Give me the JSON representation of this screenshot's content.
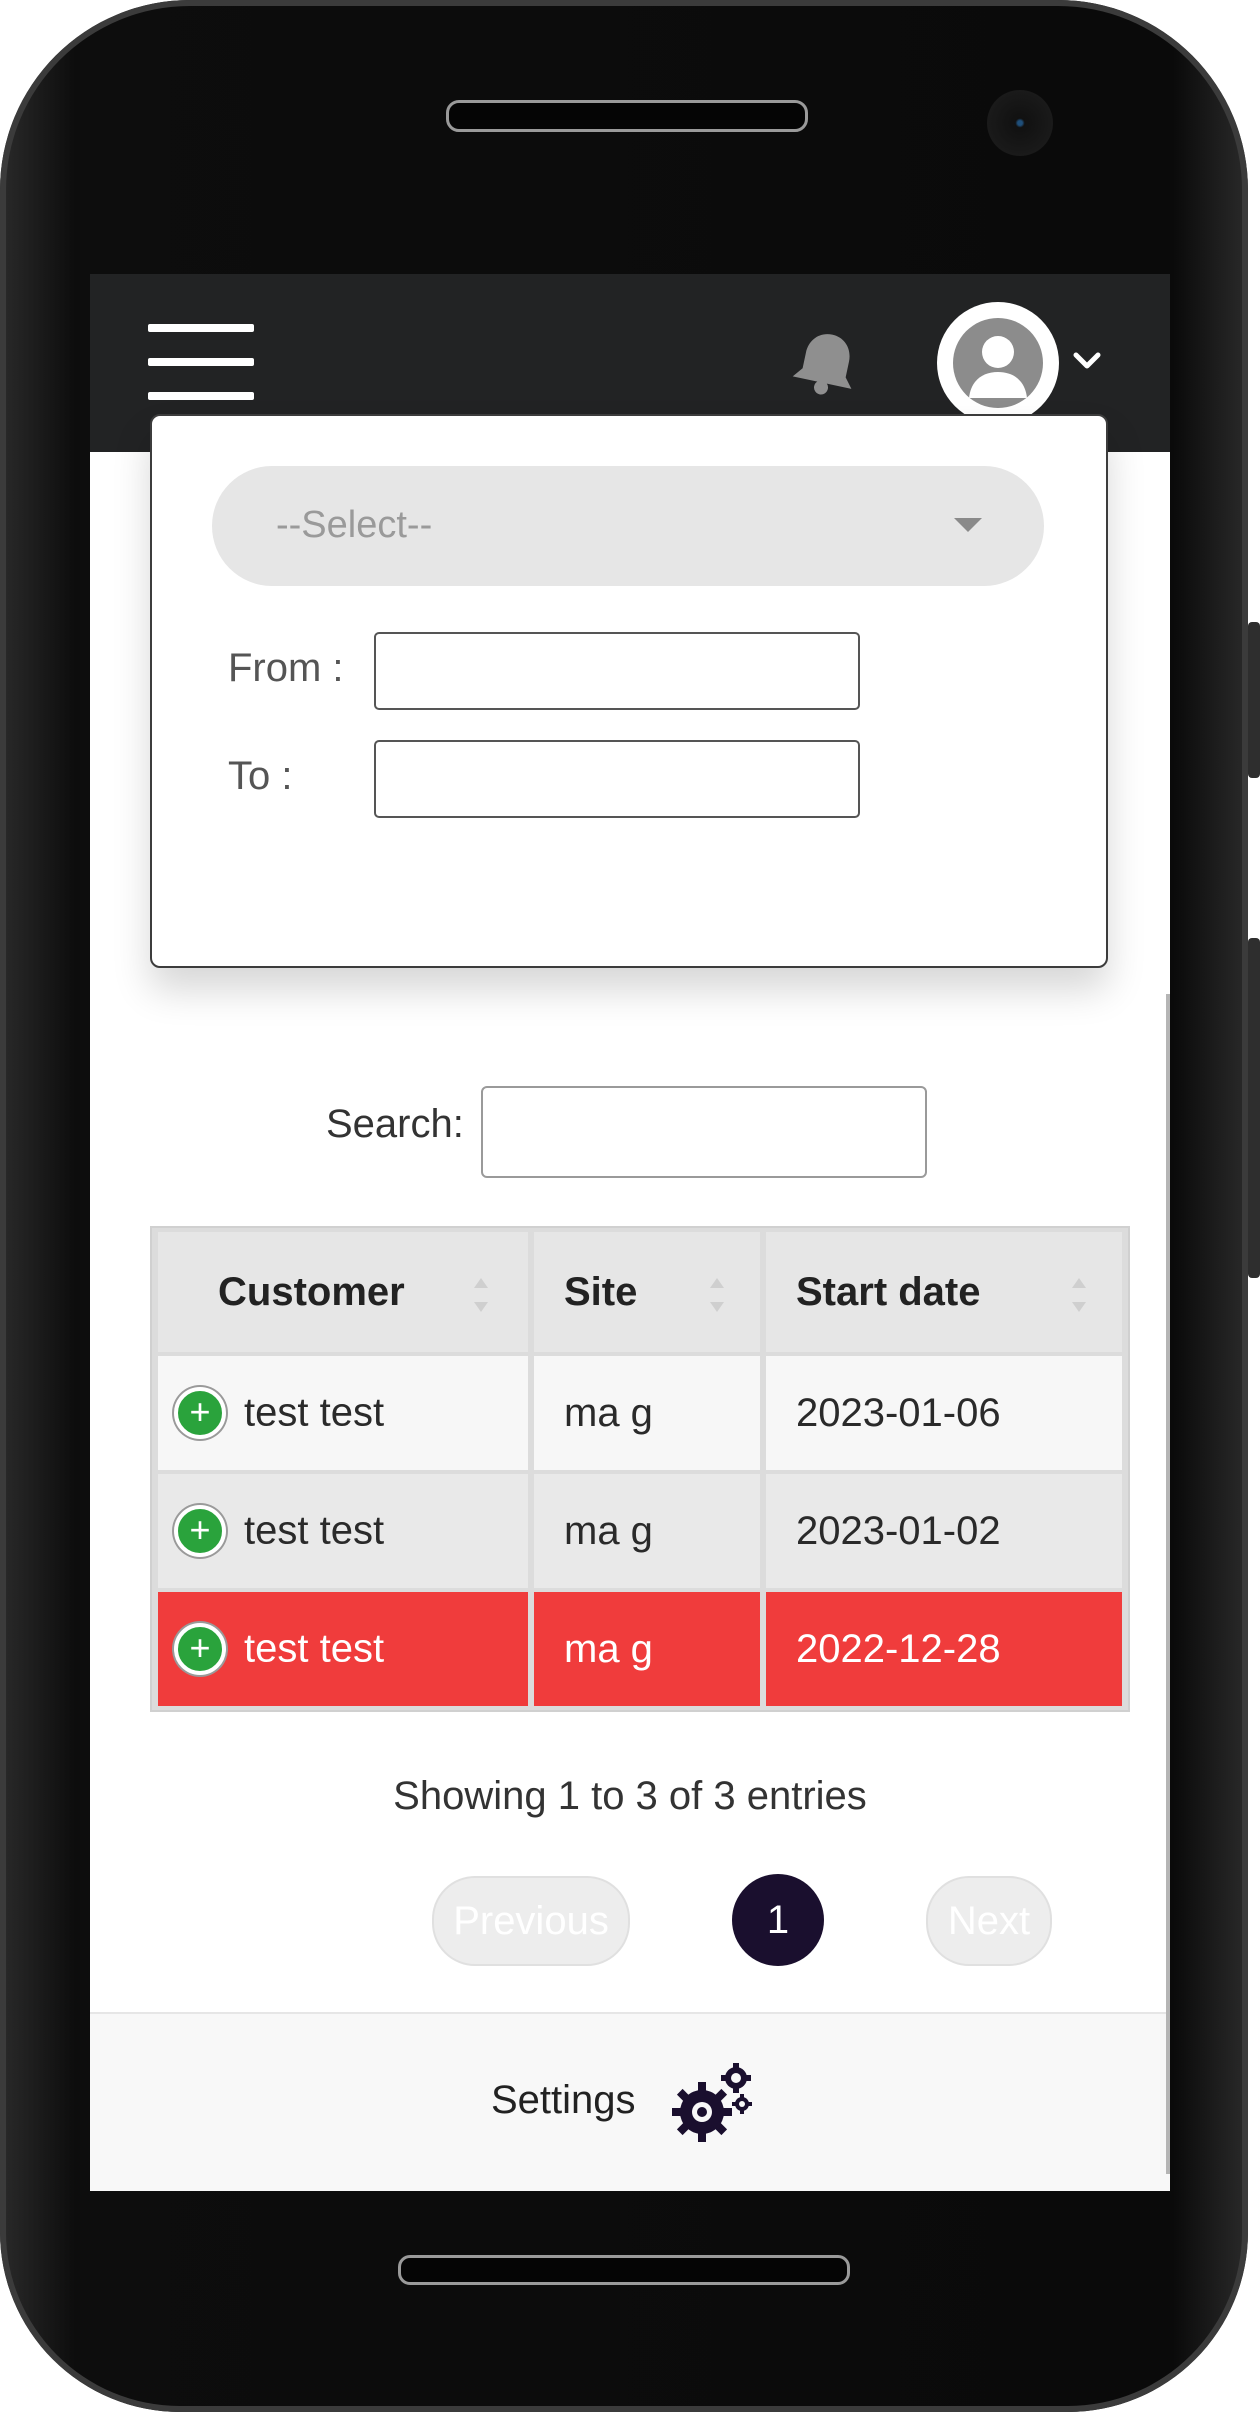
{
  "app": {
    "filter": {
      "select_placeholder": "--Select--",
      "from_label": "From :",
      "to_label": "To :",
      "from_value": "",
      "to_value": ""
    },
    "search": {
      "label": "Search:",
      "value": ""
    },
    "table": {
      "headers": [
        "Customer",
        "Site",
        "Start date"
      ],
      "rows": [
        {
          "customer": "test test",
          "site": "ma g",
          "start_date": "2023-01-06",
          "style": "normal"
        },
        {
          "customer": "test test",
          "site": "ma g",
          "start_date": "2023-01-02",
          "style": "normal"
        },
        {
          "customer": "test test",
          "site": "ma g",
          "start_date": "2022-12-28",
          "style": "highlighted-red"
        }
      ],
      "expand_icon": "plus-circle-icon"
    },
    "pagination": {
      "info": "Showing 1 to 3 of 3 entries",
      "previous": "Previous",
      "current_page": "1",
      "next": "Next"
    },
    "footer": {
      "settings_label": "Settings",
      "settings_icon": "gears-icon"
    },
    "header_icons": [
      "menu-icon",
      "bell-icon",
      "user-avatar-icon",
      "chevron-down-icon"
    ],
    "colors": {
      "topbar": "#222324",
      "alert_row": "#f03c3c",
      "expand_button": "#2aa33c",
      "active_page": "#1a0f2e"
    }
  }
}
